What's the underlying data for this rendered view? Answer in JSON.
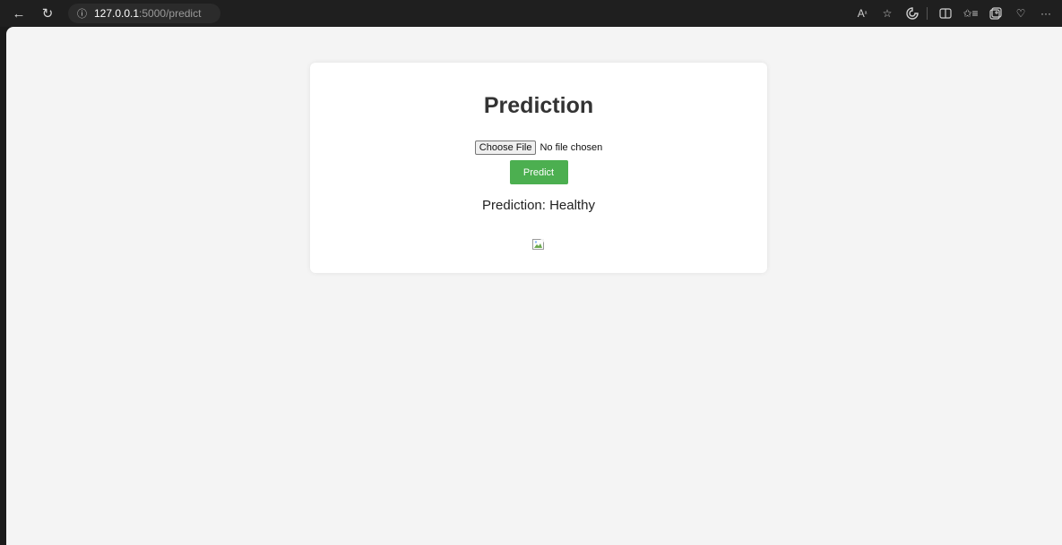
{
  "browser": {
    "url_host": "127.0.0.1",
    "url_path": ":5000/predict",
    "toolbar_icons": [
      "read-aloud-icon",
      "favorite-star-icon",
      "extensions-icon",
      "split-screen-icon",
      "favorites-list-icon",
      "collections-icon",
      "browser-essentials-icon",
      "more-icon"
    ]
  },
  "card": {
    "title": "Prediction",
    "choose_file_label": "Choose File",
    "no_file_text": "No file chosen",
    "predict_label": "Predict",
    "result_text": "Prediction: Healthy"
  },
  "colors": {
    "predict_button": "#4caf50",
    "page_background": "#f4f4f4",
    "card_background": "#ffffff"
  }
}
